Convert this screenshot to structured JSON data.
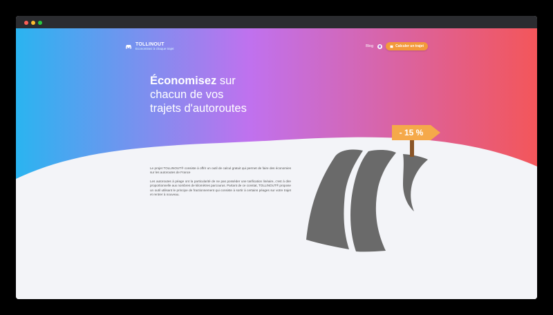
{
  "window": {
    "controls": [
      "close",
      "minimize",
      "maximize"
    ]
  },
  "brand": {
    "name": "TOLLINOUT",
    "tagline": "Economisez à chaque trajet",
    "icon": "car-icon"
  },
  "nav": {
    "blog_label": "Blog",
    "github_icon": "github-icon",
    "cta_label": "Calculer un trajet",
    "cta_icon": "map-icon"
  },
  "hero": {
    "headline_bold": "Économisez",
    "headline_rest_line1": " sur",
    "headline_line2": "chacun de vos",
    "headline_line3": "trajets d'autoroutes",
    "paragraph1": "Le projet TOLLINOUT® consiste à offrir un outil de calcul gratuit qui permet de faire des économies sur les autoroutes de France",
    "paragraph2": "Les autoroutes à péage ont la particularité de ne pas posséder une tarification linéaire, c'est à dire proportionnelle aux nombres de kilomètres parcourus. Partant de ce constat, TOLLINOUT® propose un outil utilisant le principe de fractionnement qui consiste à sortir à certains péages sur votre trajet et rentrer à nouveau.",
    "sign_label": "- 15 %"
  },
  "colors": {
    "gradient_start": "#2ab4f0",
    "gradient_mid": "#c071ee",
    "gradient_end": "#f3565a",
    "cta": "#f39a3b",
    "road": "#6a6a6a",
    "sign": "#f5a94a",
    "page_bg": "#f3f4f8"
  }
}
